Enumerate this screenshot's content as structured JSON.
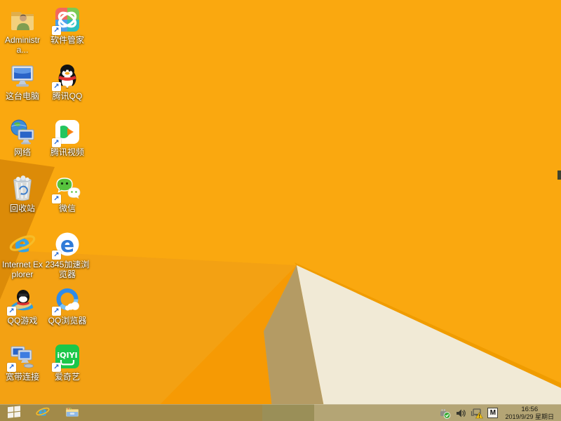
{
  "desktop": {
    "icons": [
      {
        "id": "administrator",
        "label": "Administra...",
        "icon": "user-folder",
        "shortcut": false,
        "col": 0,
        "row": 0
      },
      {
        "id": "software-manager",
        "label": "软件管家",
        "icon": "software-manager",
        "shortcut": true,
        "col": 1,
        "row": 0
      },
      {
        "id": "this-pc",
        "label": "这台电脑",
        "icon": "computer",
        "shortcut": false,
        "col": 0,
        "row": 1
      },
      {
        "id": "tencent-qq",
        "label": "腾讯QQ",
        "icon": "qq-penguin",
        "shortcut": true,
        "col": 1,
        "row": 1
      },
      {
        "id": "network",
        "label": "网络",
        "icon": "network-globe",
        "shortcut": false,
        "col": 0,
        "row": 2
      },
      {
        "id": "tencent-video",
        "label": "腾讯视频",
        "icon": "tencent-video",
        "shortcut": true,
        "col": 1,
        "row": 2
      },
      {
        "id": "recycle-bin",
        "label": "回收站",
        "icon": "recycle-bin",
        "shortcut": false,
        "col": 0,
        "row": 3
      },
      {
        "id": "wechat",
        "label": "微信",
        "icon": "wechat",
        "shortcut": true,
        "col": 1,
        "row": 3
      },
      {
        "id": "internet-explorer",
        "label": "Internet Explorer",
        "icon": "ie",
        "shortcut": false,
        "col": 0,
        "row": 4
      },
      {
        "id": "2345-browser",
        "label": "2345加速浏览器",
        "icon": "browser-2345",
        "shortcut": true,
        "col": 1,
        "row": 4
      },
      {
        "id": "qq-games",
        "label": "QQ游戏",
        "icon": "qq-games",
        "shortcut": true,
        "col": 0,
        "row": 5
      },
      {
        "id": "qq-browser",
        "label": "QQ浏览器",
        "icon": "qq-browser",
        "shortcut": true,
        "col": 1,
        "row": 5
      },
      {
        "id": "broadband",
        "label": "宽带连接",
        "icon": "broadband",
        "shortcut": true,
        "col": 0,
        "row": 6
      },
      {
        "id": "iqiyi",
        "label": "爱奇艺",
        "icon": "iqiyi",
        "shortcut": true,
        "col": 1,
        "row": 6
      }
    ]
  },
  "taskbar": {
    "buttons": [
      {
        "id": "start",
        "icon": "windows-start"
      },
      {
        "id": "ie",
        "icon": "internet-explorer"
      },
      {
        "id": "explorer",
        "icon": "file-explorer"
      }
    ],
    "tray": {
      "icons": [
        "usb-safely-remove",
        "volume",
        "network-warning",
        "ime-indicator"
      ],
      "ime_label": "M"
    },
    "clock": {
      "time": "16:56",
      "date": "2019/9/29 星期日"
    }
  },
  "wallpaper": {
    "colors": {
      "base": "#FAA80F",
      "band": "#F3A113",
      "bottom_left": "#F69A04",
      "dark_wedge": "#DC8B08",
      "khaki_shadow": "#B49B64",
      "cream": "#F1EAD6",
      "ridge": "#F09C00",
      "notch": "#3F432F"
    }
  }
}
